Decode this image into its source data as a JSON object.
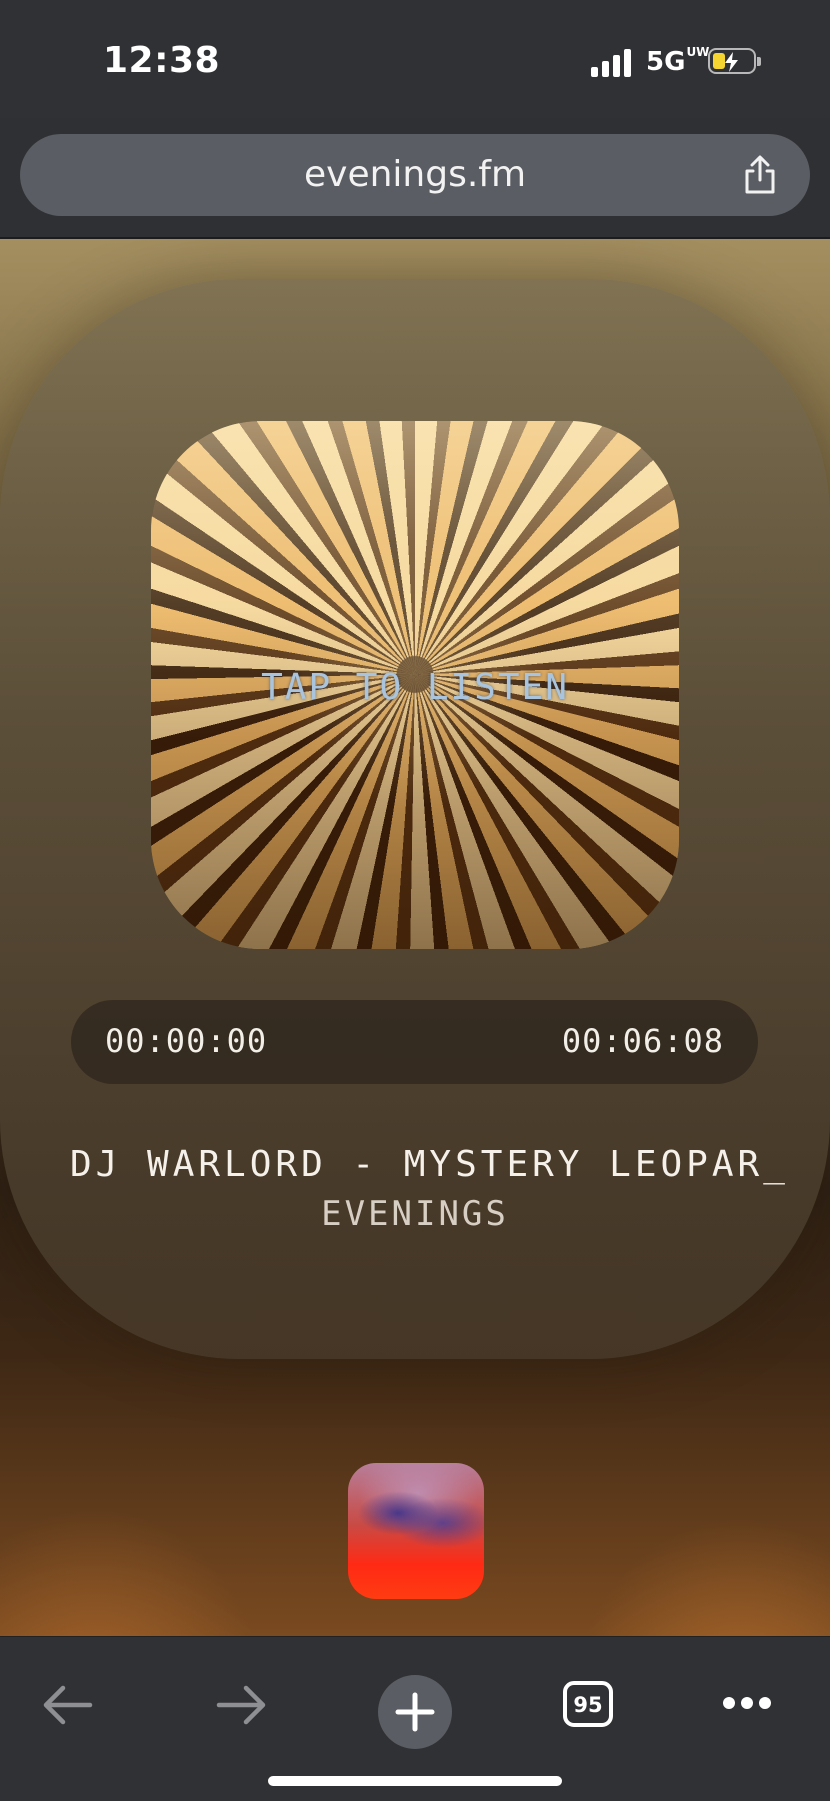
{
  "status_bar": {
    "time": "12:38",
    "network": "5G",
    "network_sup": "UW",
    "battery_color": "#f5d431"
  },
  "browser": {
    "url": "evenings.fm",
    "tab_count": "95",
    "icons": [
      "share-icon",
      "back-arrow-icon",
      "forward-arrow-icon",
      "plus-icon",
      "tabs-icon",
      "more-dots-icon"
    ]
  },
  "player": {
    "cover_label": "TAP TO LISTEN",
    "time_current": "00:00:00",
    "time_total": "00:06:08",
    "track_title": "DJ WARLORD - MYSTERY LEOPAR_",
    "artist": "EVENINGS"
  }
}
